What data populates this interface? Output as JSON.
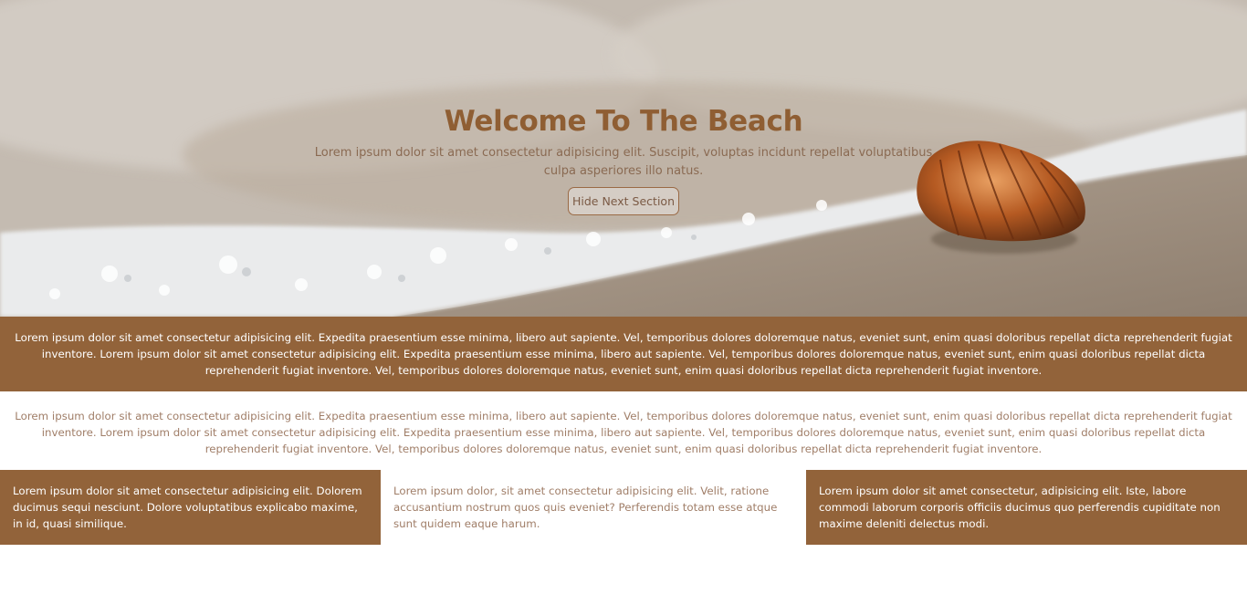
{
  "hero": {
    "title": "Welcome To The Beach",
    "text": "Lorem ipsum dolor sit amet consectetur adipisicing elit. Suscipit, voluptas incidunt repellat voluptatibus culpa asperiores illo natus.",
    "button_label": "Hide Next Section"
  },
  "section_1": {
    "text": "Lorem ipsum dolor sit amet consectetur adipisicing elit. Expedita praesentium esse minima, libero aut sapiente. Vel, temporibus dolores doloremque natus, eveniet sunt, enim quasi doloribus repellat dicta reprehenderit fugiat inventore. Lorem ipsum dolor sit amet consectetur adipisicing elit. Expedita praesentium esse minima, libero aut sapiente. Vel, temporibus dolores doloremque natus, eveniet sunt, enim quasi doloribus repellat dicta reprehenderit fugiat inventore. Vel, temporibus dolores doloremque natus, eveniet sunt, enim quasi doloribus repellat dicta reprehenderit fugiat inventore."
  },
  "section_2": {
    "text": "Lorem ipsum dolor sit amet consectetur adipisicing elit. Expedita praesentium esse minima, libero aut sapiente. Vel, temporibus dolores doloremque natus, eveniet sunt, enim quasi doloribus repellat dicta reprehenderit fugiat inventore. Lorem ipsum dolor sit amet consectetur adipisicing elit. Expedita praesentium esse minima, libero aut sapiente. Vel, temporibus dolores doloremque natus, eveniet sunt, enim quasi doloribus repellat dicta reprehenderit fugiat inventore. Vel, temporibus dolores doloremque natus, eveniet sunt, enim quasi doloribus repellat dicta reprehenderit fugiat inventore."
  },
  "columns": [
    {
      "text": "Lorem ipsum dolor sit amet consectetur adipisicing elit. Dolorem ducimus sequi nesciunt. Dolore voluptatibus explicabo maxime, in id, quasi similique."
    },
    {
      "text": "Lorem ipsum dolor, sit amet consectetur adipisicing elit. Velit, ratione accusantium nostrum quos quis eveniet? Perferendis totam esse atque sunt quidem eaque harum."
    },
    {
      "text": "Lorem ipsum dolor sit amet consectetur, adipisicing elit. Iste, labore commodi laborum corporis officiis ducimus quo perferendis cupiditate non maxime deleniti delectus modi."
    }
  ],
  "colors": {
    "accent_brown": "#92633a",
    "title_brown": "#8f5e33",
    "muted_text": "#a07e68"
  }
}
